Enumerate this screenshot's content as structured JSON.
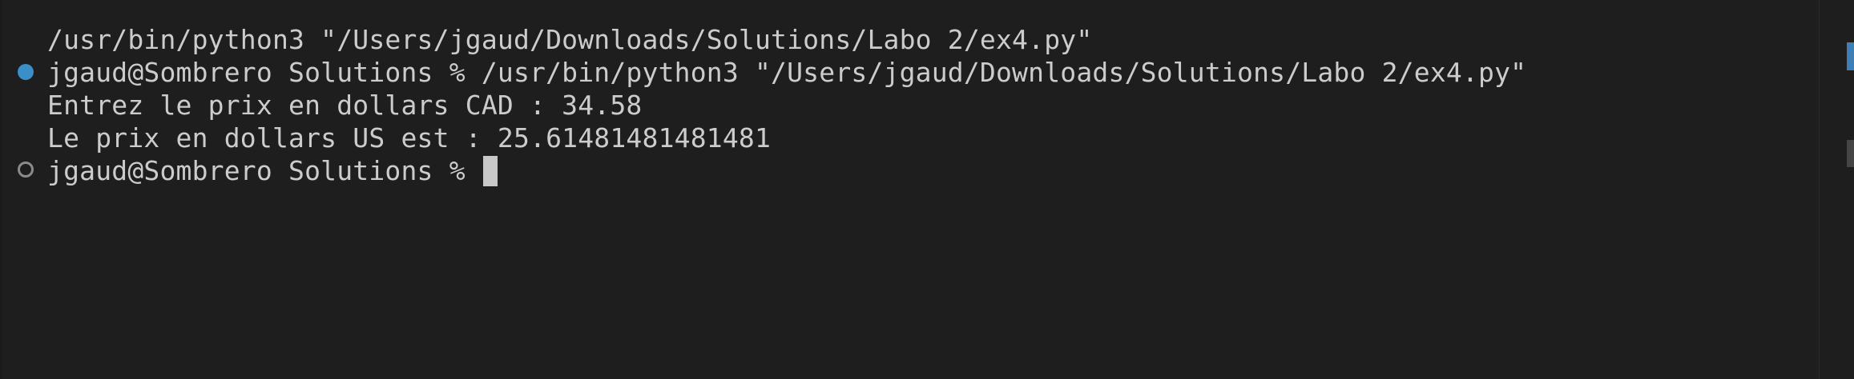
{
  "terminal": {
    "lines": [
      "/usr/bin/python3 \"/Users/jgaud/Downloads/Solutions/Labo 2/ex4.py\"",
      "jgaud@Sombrero Solutions % /usr/bin/python3 \"/Users/jgaud/Downloads/Solutions/Labo 2/ex4.py\"",
      "Entrez le prix en dollars CAD : 34.58",
      "Le prix en dollars US est : 25.61481481481481"
    ],
    "prompt": "jgaud@Sombrero Solutions % "
  },
  "colors": {
    "background": "#1e1e1e",
    "text": "#cccccc",
    "success_decoration": "#3a8fc9",
    "pending_decoration": "#8b8b8b",
    "cursor": "#c8c8c8"
  },
  "icons": {
    "command_success": "filled-circle-icon",
    "command_pending": "hollow-circle-icon"
  }
}
